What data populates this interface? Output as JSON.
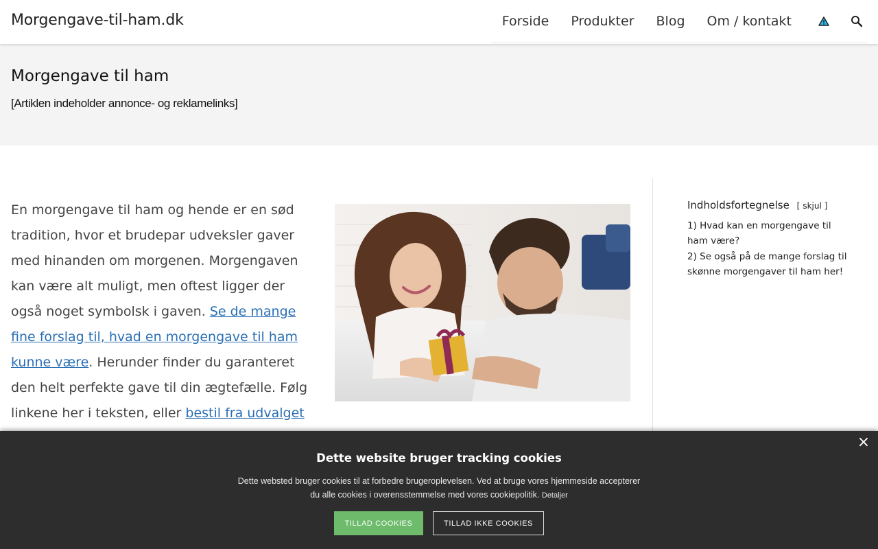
{
  "header": {
    "site_title": "Morgengave-til-ham.dk",
    "nav": [
      "Forside",
      "Produkter",
      "Blog",
      "Om / kontakt"
    ],
    "icons": [
      "warning-icon",
      "search-icon"
    ]
  },
  "page": {
    "title": "Morgengave til ham",
    "disclaimer": "[Artiklen indeholder annonce- og reklamelinks]"
  },
  "article": {
    "text_1": "En morgengave til ham og hende er en sød tradition, hvor et brudepar udveksler gaver med hinanden om morgenen. Morgengaven kan være alt muligt, men oftest ligger der også noget symbolsk i gaven. ",
    "link_1": "Se de mange fine forslag til, hvad en morgengave til ham kunne være",
    "text_2": ". Herunder finder du garanteret den helt perfekte gave til din ægtefælle. Følg linkene her i teksten, eller ",
    "link_2": "bestil fra udvalget nederst"
  },
  "toc": {
    "heading": "Indholdsfortegnelse",
    "toggle_open": "[",
    "toggle_label": "skjul",
    "toggle_close": "]",
    "items": [
      "1) Hvad kan en morgengave til ham være?",
      "2) Se også på de mange forslag til skønne morgengaver til ham her!"
    ]
  },
  "cookie": {
    "close": "×",
    "title": "Dette website bruger tracking cookies",
    "text": "Dette websted bruger cookies til at forbedre brugeroplevelsen. Ved at bruge vores hjemmeside accepterer du alle cookies i overensstemmelse med vores cookiepolitik. ",
    "details_link": "Detaljer",
    "allow_button": "TILLAD COOKIES",
    "deny_button": "TILLAD IKKE COOKIES"
  },
  "colors": {
    "link": "#2a6fb5",
    "cookie_bg": "#2d2d2d",
    "allow_button": "#6dbb6b",
    "title_band": "#f4f4f4"
  }
}
